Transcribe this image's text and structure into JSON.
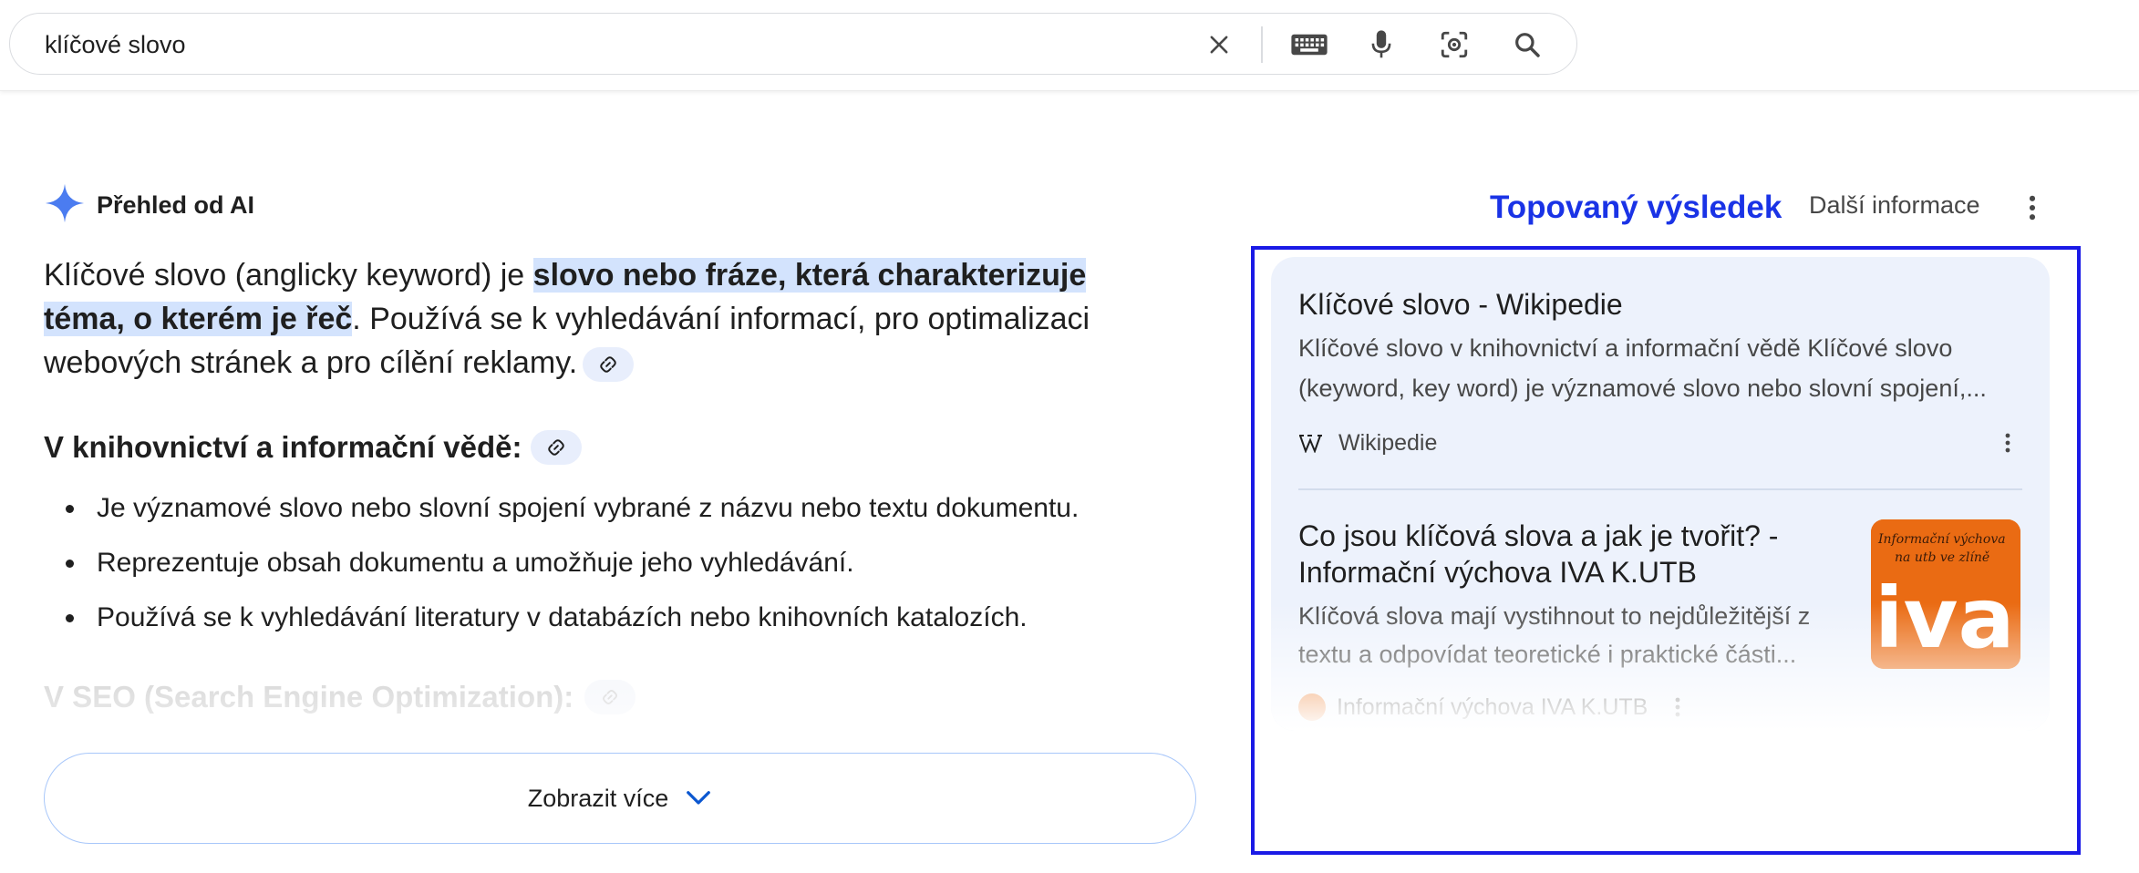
{
  "search": {
    "query": "klíčové slovo"
  },
  "icons": {
    "clear": "close-icon",
    "keyboard": "keyboard-icon",
    "mic": "mic-icon",
    "lens": "lens-icon",
    "search": "search-icon"
  },
  "ai_overview": {
    "header": "Přehled od AI",
    "para_part1": "Klíčové slovo (anglicky keyword) je ",
    "para_highlight": "slovo nebo fráze, která charakterizuje téma, o kterém je řeč",
    "para_part2": ". Používá se k vyhledávání informací, pro optimalizaci webových stránek a pro cílění reklamy.",
    "section1_heading": "V knihovnictví a informační vědě:",
    "section1_items": [
      "Je významové slovo nebo slovní spojení vybrané z názvu nebo textu dokumentu.",
      "Reprezentuje obsah dokumentu a umožňuje jeho vyhledávání.",
      "Používá se k vyhledávání literatury v databázích nebo knihovních katalozích."
    ],
    "section2_heading": "V SEO (Search Engine Optimization):",
    "show_more": "Zobrazit více"
  },
  "right_panel": {
    "top_result_label": "Topovaný výsledek",
    "more_info": "Další informace",
    "results": [
      {
        "title": "Klíčové slovo - Wikipedie",
        "snippet_line1": "Klíčové slovo v knihovnictví a informační vědě Klíčové slovo",
        "snippet_line2": "(keyword, key word) je významové slovo nebo slovní spojení,...",
        "source": "Wikipedie"
      },
      {
        "title_line1": "Co jsou klíčová slova a jak je tvořit? -",
        "title_line2": "Informační výchova IVA K.UTB",
        "snippet_line1": "Klíčová slova mají vystihnout to nejdůležitější z",
        "snippet_line2": "textu a odpovídat teoretické i praktické části...",
        "source": "Informační výchova IVA K.UTB",
        "thumb_text_top": "Informační výchova",
        "thumb_text_mid": "na utb ve zlíně",
        "thumb_logo": "iva"
      }
    ]
  },
  "colors": {
    "accent_blue": "#1a33e6",
    "highlight": "#d3e3fd",
    "card_bg": "#edf2fc",
    "thumb_orange": "#ea6b13"
  }
}
